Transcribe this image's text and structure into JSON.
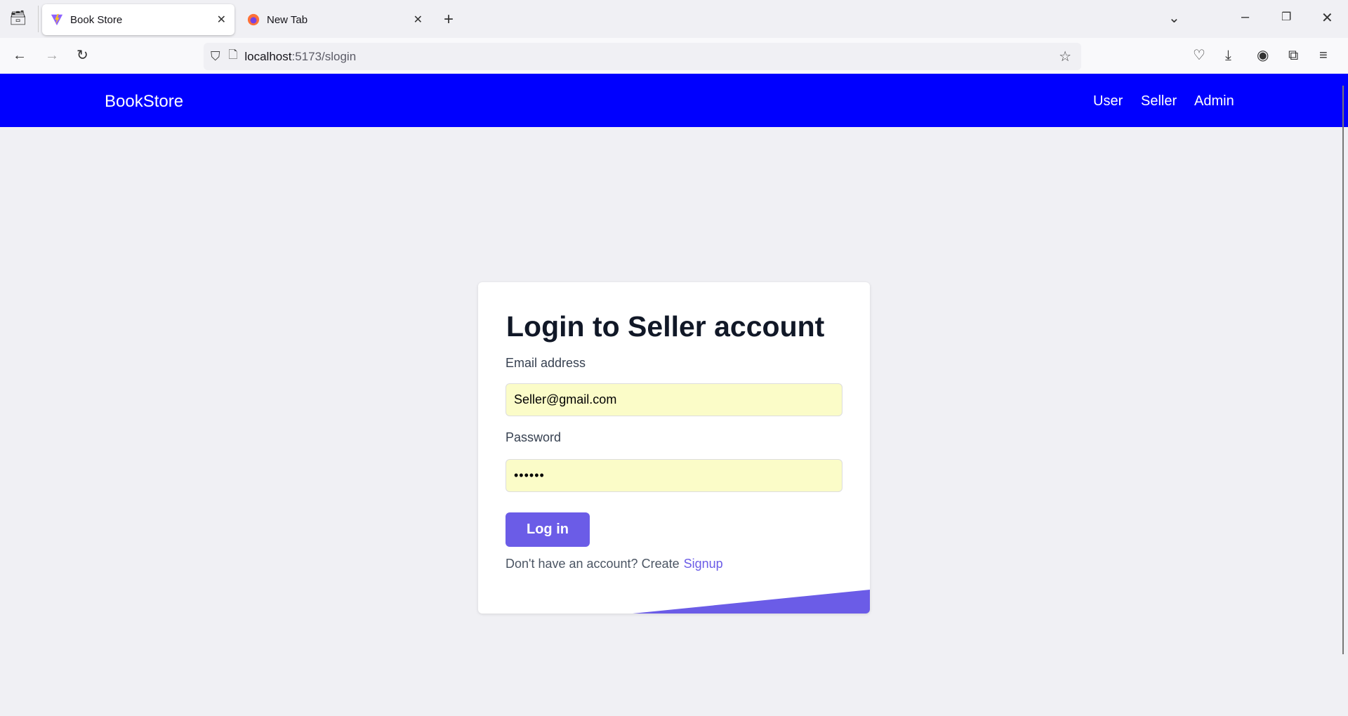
{
  "browser": {
    "tabs": [
      {
        "title": "Book Store",
        "active": true,
        "icon": "vite-icon"
      },
      {
        "title": "New Tab",
        "active": false,
        "icon": "firefox-icon"
      }
    ],
    "url_host": "localhost",
    "url_path": ":5173/slogin"
  },
  "navbar": {
    "brand": "BookStore",
    "links": [
      "User",
      "Seller",
      "Admin"
    ],
    "color": "#0000ff"
  },
  "form": {
    "title": "Login to Seller account",
    "email_label": "Email address",
    "email_value": "Seller@gmail.com",
    "password_label": "Password",
    "password_value": "••••••",
    "login_label": "Log in",
    "signup_prompt": "Don't have an account? Create",
    "signup_link": "Signup",
    "accent": "#6b5ce7"
  }
}
